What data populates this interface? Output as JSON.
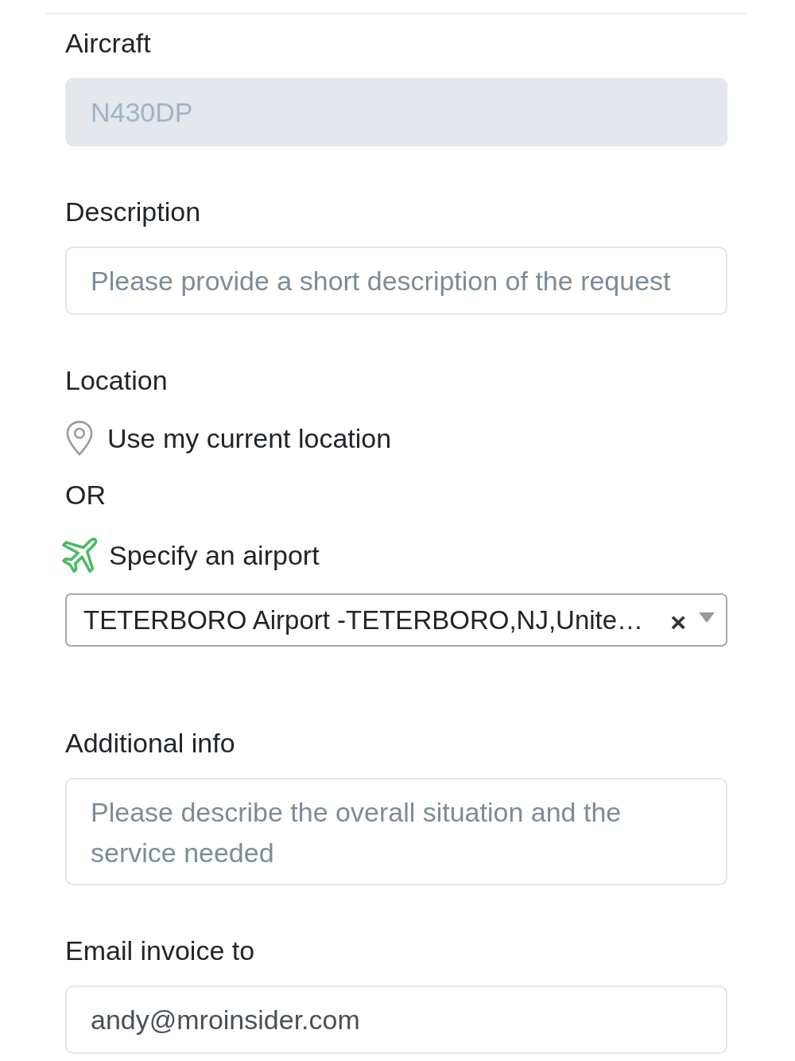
{
  "aircraft": {
    "label": "Aircraft",
    "value": "N430DP",
    "disabled": true
  },
  "description": {
    "label": "Description",
    "placeholder": "Please provide a short description of the request",
    "disabled": false
  },
  "location": {
    "label": "Location",
    "options": [
      {
        "kind": "current",
        "label": "Use my current location",
        "selected": false
      },
      {
        "kind": "airport",
        "label": "Specify an airport",
        "selected": true
      }
    ],
    "separator": "OR",
    "airport_select": {
      "value": "TETERBORO Airport -TETERBORO,NJ,Unite…",
      "clear": "×"
    }
  },
  "additional_info": {
    "label": "Additional info",
    "placeholder": "Please describe the overall situation and the service needed",
    "disabled": false
  },
  "email_invoice": {
    "label": "Email invoice to",
    "value": "andy@mroinsider.com",
    "disabled": false
  }
}
